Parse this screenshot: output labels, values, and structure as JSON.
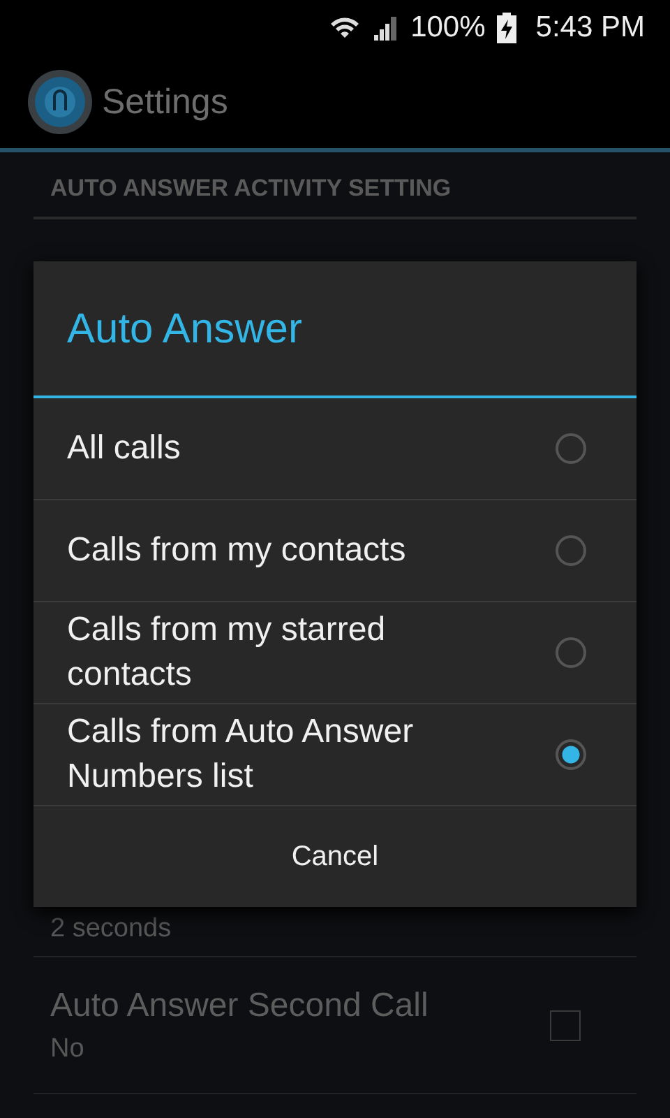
{
  "status_bar": {
    "battery": "100%",
    "time": "5:43 PM"
  },
  "action_bar": {
    "title": "Settings"
  },
  "section_header": "AUTO ANSWER ACTIVITY SETTING",
  "settings": [
    {
      "kind": "summary",
      "summary": "2 seconds"
    },
    {
      "kind": "checkbox",
      "title": "Auto Answer Second Call",
      "summary": "No",
      "checked": false
    }
  ],
  "dialog": {
    "title": "Auto Answer",
    "options": [
      {
        "label": "All calls",
        "selected": false
      },
      {
        "label": "Calls from my contacts",
        "selected": false
      },
      {
        "label": "Calls from my starred contacts",
        "selected": false
      },
      {
        "label": "Calls from Auto Answer Numbers list",
        "selected": true
      }
    ],
    "button": "Cancel"
  }
}
